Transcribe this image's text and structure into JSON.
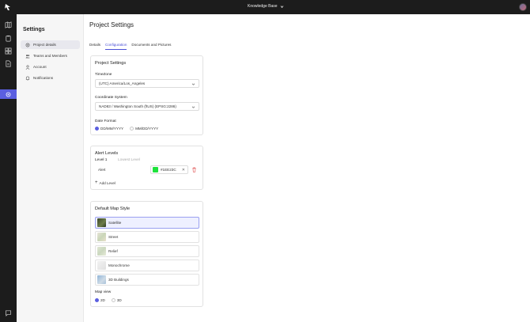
{
  "topbar": {
    "workspace_label": "Knowledge Base"
  },
  "sidebar": {
    "title": "Settings",
    "items": [
      {
        "label": "Project details",
        "icon": "gear-icon"
      },
      {
        "label": "Teams and Members",
        "icon": "people-icon"
      },
      {
        "label": "Account",
        "icon": "person-icon"
      },
      {
        "label": "Notifications",
        "icon": "bell-icon"
      }
    ]
  },
  "main": {
    "title": "Project Settings",
    "tabs": [
      {
        "label": "Details"
      },
      {
        "label": "Configuration"
      },
      {
        "label": "Documents and Pictures"
      }
    ],
    "project_settings": {
      "title": "Project Settings",
      "timezone_label": "TimeZone",
      "timezone_value": "(UTC) America/Los_Angeles",
      "coord_label": "Coordinate System",
      "coord_value": "NAD83 / Washington South (ftUS) (EPSG:2286)",
      "date_label": "Date Format",
      "date_options": [
        "DD/MM/YYYY",
        "MM/DD/YYYY"
      ]
    },
    "alert_levels": {
      "title": "Alert Levels",
      "level_label": "Level 1",
      "level_hint": "Lowest Level",
      "alert_name": "Alert",
      "alert_color": "#1EE23C",
      "add_label": "Add Level"
    },
    "map_style": {
      "title": "Default Map Style",
      "options": [
        "Satellite",
        "Street",
        "Relief",
        "Monochrome",
        "3D Buildings"
      ],
      "map_view_label": "Map view",
      "view_options": [
        "2D",
        "3D"
      ]
    }
  },
  "colors": {
    "accent": "#5b5fe0",
    "topbar": "#1c1c1c",
    "alert_swatch": "#1ee23c"
  }
}
